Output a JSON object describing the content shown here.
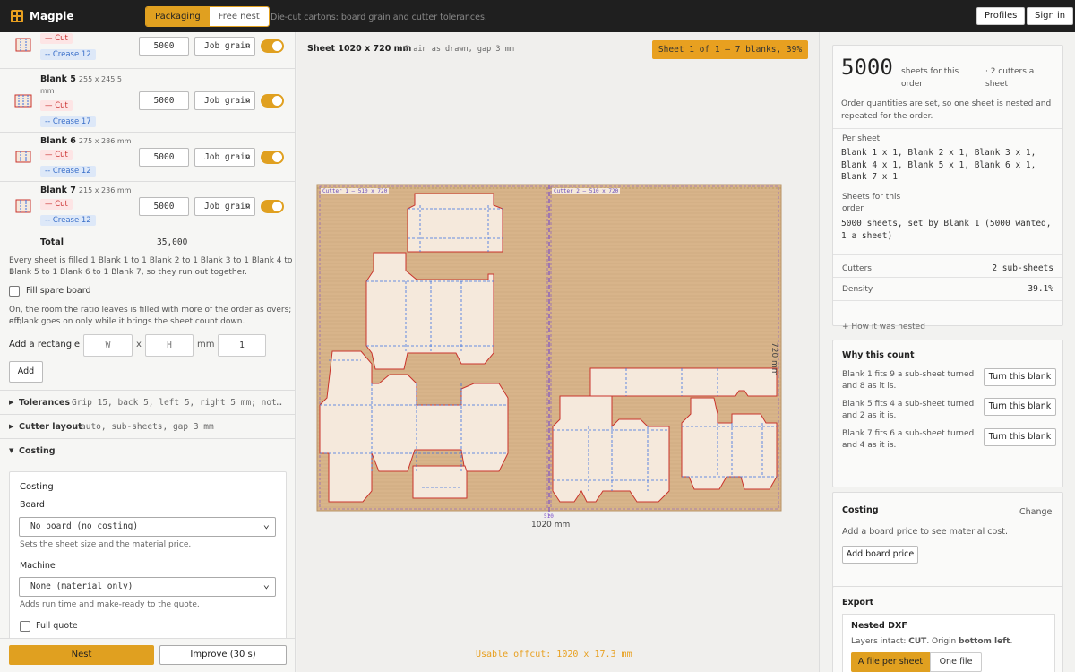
{
  "app": {
    "name": "Magpie",
    "tagline": "Die-cut cartons: board grain and cutter tolerances."
  },
  "mode_tabs": [
    {
      "label": "Packaging",
      "active": true
    },
    {
      "label": "Free nest",
      "active": false
    }
  ],
  "header_buttons": {
    "profiles": "Profiles",
    "signin": "Sign in"
  },
  "left": {
    "blanks": [
      {
        "name": "",
        "dims": "",
        "cut": "Cut",
        "crease": "Crease 12",
        "qty": "5000",
        "mode": "Job grain",
        "enabled": true
      },
      {
        "name": "Blank 5",
        "dims": "255 x 245.5",
        "dims2": "mm",
        "cut": "Cut",
        "crease": "Crease 17",
        "qty": "5000",
        "mode": "Job grain",
        "enabled": true
      },
      {
        "name": "Blank 6",
        "dims": "275 x 286 mm",
        "cut": "Cut",
        "crease": "Crease 12",
        "qty": "5000",
        "mode": "Job grain",
        "enabled": true
      },
      {
        "name": "Blank 7",
        "dims": "215 x 236 mm",
        "cut": "Cut",
        "crease": "Crease 12",
        "qty": "5000",
        "mode": "Job grain",
        "enabled": true
      }
    ],
    "total_label": "Total",
    "total_value": "35,000",
    "ratio_text_1": "Every sheet is filled 1 Blank 1 to 1 Blank 2 to 1 Blank 3 to 1 Blank 4 to 1",
    "ratio_text_2": "Blank 5 to 1 Blank 6 to 1 Blank 7, so they run out together.",
    "fill_spare_label": "Fill spare board",
    "fill_spare_help_1": "On, the room the ratio leaves is filled with more of the order as overs; off,",
    "fill_spare_help_2": "a blank goes on only while it brings the sheet count down.",
    "add_rect_label": "Add a rectangle",
    "w_placeholder": "W",
    "h_placeholder": "H",
    "x_sep": "x",
    "unit": "mm",
    "count": "1",
    "add_button": "Add",
    "sections": [
      {
        "title": "Tolerances",
        "summary": "Grip 15, back 5, left 5, right 5 mm; not…"
      },
      {
        "title": "Cutter layout",
        "summary": "auto, sub-sheets, gap 3 mm"
      },
      {
        "title": "Costing",
        "summary": ""
      }
    ],
    "costing": {
      "card_title": "Costing",
      "board_label": "Board",
      "board_value": "No board (no costing)",
      "board_help": "Sets the sheet size and the material price.",
      "machine_label": "Machine",
      "machine_value": "None (material only)",
      "machine_help": "Adds run time and make-ready to the quote.",
      "full_quote": "Full quote"
    },
    "nest_button": "Nest",
    "improve_button": "Improve (30 s)"
  },
  "center": {
    "sheet_title": "Sheet 1020 x 720 mm",
    "sheet_sub": "Grain as drawn, gap 3 mm",
    "badge": "Sheet 1 of 1 — 7 blanks, 39%",
    "cutter1": "Cutter 1 — 510 x 720",
    "cutter2": "Cutter 2 — 510 x 720",
    "width_label": "1020 mm",
    "height_label": "720 mm",
    "mid_label": "510",
    "offcut": "Usable offcut: 1020 x 17.3 mm",
    "colors": {
      "board": "#d8b48a",
      "blank_fill": "#f5e9dc",
      "cut": "#c9342c",
      "crease": "#3a6fe0",
      "cutter_line": "#7b4fc9"
    }
  },
  "right": {
    "qty_big": "5000",
    "qty_label": "sheets for this order",
    "cutters_label": "· 2 cutters a sheet",
    "order_note": "Order quantities are set, so one sheet is nested and repeated for the order.",
    "per_sheet_label": "Per sheet",
    "per_sheet_lines": [
      "Blank 1 x 1, Blank 2 x 1, Blank 3 x 1,",
      "Blank 4 x 1, Blank 5 x 1, Blank 6 x 1,",
      "Blank 7 x 1"
    ],
    "sheets_order_label": "Sheets for this order",
    "sheets_order_lines": [
      "5000 sheets, set by Blank 1 (5000 wanted,",
      "1 a sheet)"
    ],
    "cutters_key": "Cutters",
    "cutters_val": "2 sub-sheets",
    "density_key": "Density",
    "density_val": "39.1%",
    "how_nested": "+ How it was nested",
    "why_title": "Why this count",
    "why_rows": [
      {
        "text1": "Blank 1 fits 9 a sub-sheet turned",
        "text2": "and 8 as it is.",
        "button": "Turn this blank"
      },
      {
        "text1": "Blank 5 fits 4 a sub-sheet turned",
        "text2": "and 2 as it is.",
        "button": "Turn this blank"
      },
      {
        "text1": "Blank 7 fits 6 a sub-sheet turned",
        "text2": "and 4 as it is.",
        "button": "Turn this blank"
      }
    ],
    "costing_title": "Costing",
    "costing_change": "Change",
    "costing_text": "Add a board price to see material cost.",
    "costing_button": "Add board price",
    "export_title": "Export",
    "dxf_title": "Nested DXF",
    "dxf_text_a": "Layers intact: ",
    "dxf_cut": "CUT",
    "dxf_text_b": ". Origin ",
    "dxf_origin": "bottom left",
    "dxf_text_c": ".",
    "file_per_sheet": "A file per sheet",
    "one_file": "One file"
  }
}
